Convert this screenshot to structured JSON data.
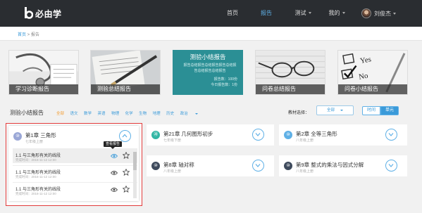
{
  "app": {
    "logo_text": "必由学"
  },
  "nav": {
    "items": [
      {
        "label": "首页"
      },
      {
        "label": "报告"
      },
      {
        "label": "测试"
      },
      {
        "label": "我的"
      }
    ],
    "user_name": "刘俊杰"
  },
  "breadcrumb": {
    "home": "首页",
    "separator": " > ",
    "current": "报告"
  },
  "report_cards": [
    {
      "label": "学习诊断报告"
    },
    {
      "label": "测验总结报告"
    },
    {
      "label": "测验小结报告",
      "desc": "报告总结报告总结报告报告总结报告总结报告总结报告",
      "stats": [
        "报告数：100份",
        "今日报告数：1份"
      ]
    },
    {
      "label": "问卷总结报告"
    },
    {
      "label": "问卷小结报告"
    }
  ],
  "section": {
    "title": "测验小结报告",
    "subjects": [
      "全部",
      "语文",
      "数学",
      "英语",
      "物理",
      "化学",
      "生物",
      "地理",
      "历史",
      "政治"
    ],
    "textbook_label": "教材选择：",
    "textbook_value": "全部",
    "toggle": [
      "时间",
      "单元"
    ]
  },
  "chapters": [
    {
      "num": "⑩",
      "title": "第1章  三角形",
      "grade": "七年级上册",
      "color": "#9aa7d6",
      "direction": "up"
    },
    {
      "num": "⑳",
      "title": "第21章  几何图形初步",
      "grade": "七年级下册",
      "color": "#31b6a4",
      "direction": "down"
    },
    {
      "num": "⑩",
      "title": "第2章  全等三角形",
      "grade": "八年级上册",
      "color": "#5fb0e6",
      "direction": "down"
    },
    {
      "num": "⑩",
      "title": "第8章  轴对称",
      "grade": "八年级上册",
      "color": "#3e4a5c",
      "direction": "down"
    },
    {
      "num": "⑩",
      "title": "第9章  整式的乘法与因式分解",
      "grade": "八年级上册",
      "color": "#3e4a5c",
      "direction": "down"
    }
  ],
  "lessons": [
    {
      "title": "1.1  与三角形有关的线段",
      "time": "完成时间：2016-11-12 12:00"
    },
    {
      "title": "1.1  与三角形有关的线段",
      "time": "完成时间：2016-11-12 12:00"
    },
    {
      "title": "1.1  与三角形有关的线段",
      "time": "完成时间：2016-11-12 12:00"
    }
  ],
  "tooltip": "查看报告",
  "colors": {
    "accent": "#3a9ad9",
    "active_subject": "#f39c2f",
    "highlight": "#e23b3b",
    "nav_bg": "#2a2d31"
  }
}
